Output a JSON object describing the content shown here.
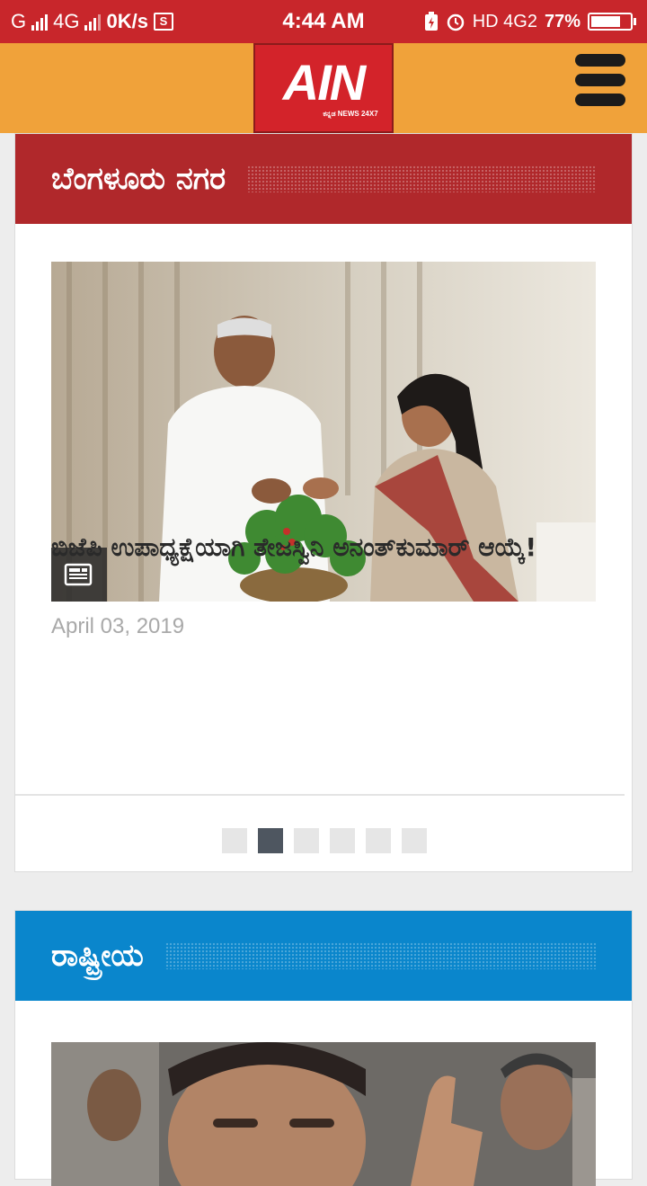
{
  "status_bar": {
    "carrier1": "G",
    "net1": "4G",
    "speed": "0K/s",
    "sim_label": "S",
    "time": "4:44 AM",
    "hd_net": "HD 4G2",
    "battery_pct": "77%",
    "battery_level": 0.77,
    "icons": [
      "signal-icon",
      "sim-icon",
      "charging-icon",
      "alarm-icon",
      "battery-icon"
    ]
  },
  "header": {
    "logo_text": "AIN",
    "logo_sub": "ಕನ್ನಡ NEWS 24X7",
    "menu_icon": "hamburger-menu-icon",
    "bg_color": "#f0a23a",
    "logo_color": "#d3232a"
  },
  "sections": [
    {
      "category": "ಬೆಂಗಳೂರು ನಗರ",
      "color": "#b0282b",
      "headline": "ಬಿಜೆಪಿ ಉಪಾಧ್ಯಕ್ಷೆಯಾಗಿ ತೇಜಸ್ವಿನಿ ಅನಂತ್‌ಕುಮಾರ್ ಆಯ್ಕೆ!",
      "date": "April 03, 2019",
      "article_icon": "newspaper-icon",
      "pager_count": 6,
      "pager_active": 2
    },
    {
      "category": "ರಾಷ್ಟ್ರೀಯ",
      "color": "#0a86cc"
    }
  ]
}
